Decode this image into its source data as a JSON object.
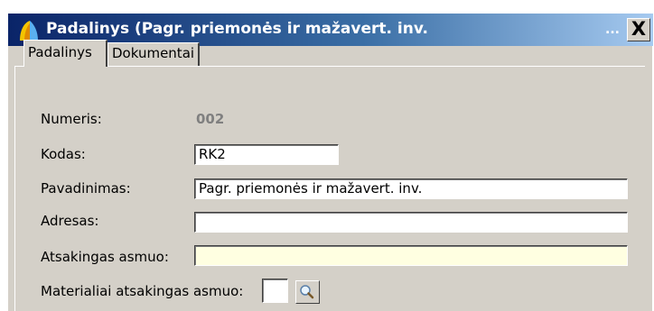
{
  "window": {
    "title": "Padalinys  (Pagr. priemonės ir mažavert. inv.",
    "title_overflow": "...",
    "close_label": "X"
  },
  "tabs": [
    {
      "label": "Padalinys",
      "active": true
    },
    {
      "label": "Dokumentai",
      "active": false
    }
  ],
  "form": {
    "numeris_label": "Numeris:",
    "numeris_value": "002",
    "kodas_label": "Kodas:",
    "kodas_value": "RK2",
    "pavadinimas_label": "Pavadinimas:",
    "pavadinimas_value": "Pagr. priemonės ir mažavert. inv.",
    "adresas_label": "Adresas:",
    "adresas_value": "",
    "atsakingas_label": "Atsakingas asmuo:",
    "atsakingas_value": "",
    "materialiai_label": "Materialiai atsakingas asmuo:",
    "materialiai_value": ""
  },
  "icons": {
    "app": "app-logo-icon",
    "lookup": "magnifier-icon"
  },
  "colors": {
    "titlebar_start": "#0a2468",
    "titlebar_end": "#a6caf0",
    "window_bg": "#d4d0c8",
    "required_field_bg": "#ffffe1"
  }
}
